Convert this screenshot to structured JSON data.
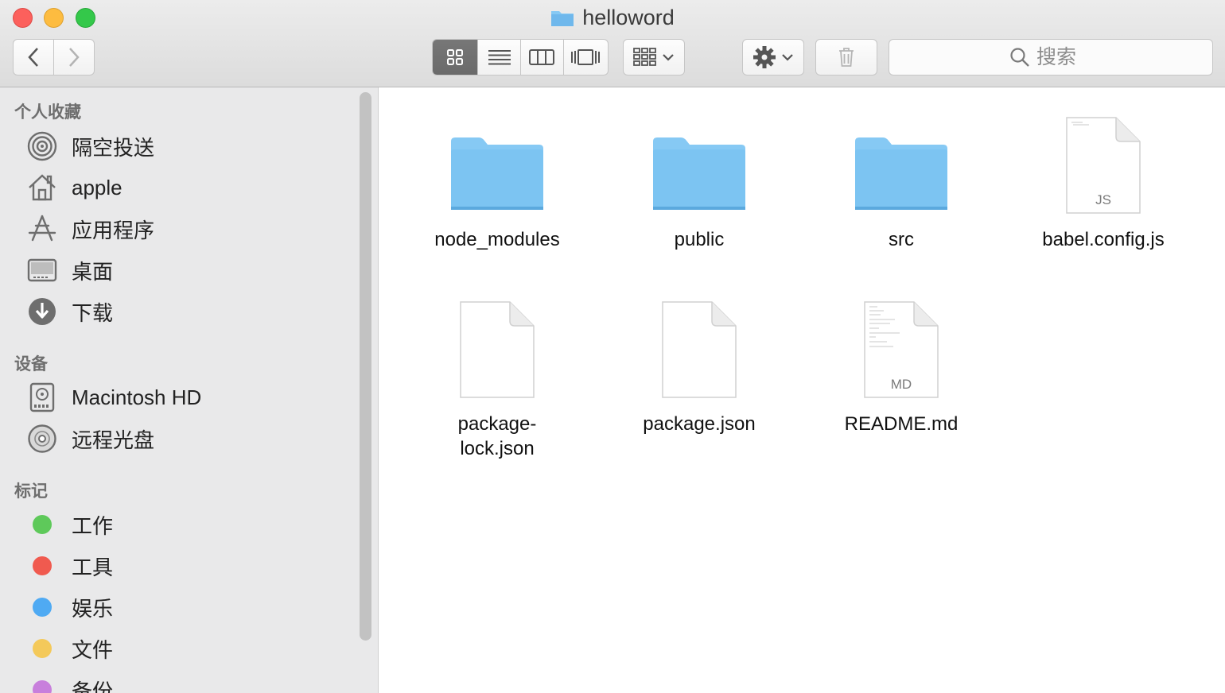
{
  "window": {
    "title": "helloword"
  },
  "toolbar": {
    "nav": {
      "back": "back-icon",
      "forward": "forward-icon"
    },
    "view_modes": [
      "icon-view-icon",
      "list-view-icon",
      "column-view-icon",
      "cover-flow-icon"
    ],
    "active_view": 0,
    "search": {
      "placeholder": "搜索"
    }
  },
  "sidebar": {
    "favorites": {
      "title": "个人收藏",
      "items": [
        {
          "label": "隔空投送",
          "icon": "airdrop-icon"
        },
        {
          "label": "apple",
          "icon": "home-icon"
        },
        {
          "label": "应用程序",
          "icon": "applications-icon"
        },
        {
          "label": "桌面",
          "icon": "desktop-icon"
        },
        {
          "label": "下载",
          "icon": "download-icon"
        }
      ]
    },
    "devices": {
      "title": "设备",
      "items": [
        {
          "label": "Macintosh HD",
          "icon": "hard-drive-icon"
        },
        {
          "label": "远程光盘",
          "icon": "disc-icon"
        }
      ]
    },
    "tags": {
      "title": "标记",
      "items": [
        {
          "label": "工作",
          "color": "#5ec95a"
        },
        {
          "label": "工具",
          "color": "#f05a4f"
        },
        {
          "label": "娱乐",
          "color": "#4faaf3"
        },
        {
          "label": "文件",
          "color": "#f4c95a"
        },
        {
          "label": "备份",
          "color": "#c87fdc"
        }
      ]
    }
  },
  "files": [
    {
      "name": "node_modules",
      "kind": "folder"
    },
    {
      "name": "public",
      "kind": "folder"
    },
    {
      "name": "src",
      "kind": "folder"
    },
    {
      "name": "babel.config.js",
      "kind": "document",
      "badge": "JS"
    },
    {
      "name": "package-lock.json",
      "kind": "document",
      "badge": ""
    },
    {
      "name": "package.json",
      "kind": "document",
      "badge": ""
    },
    {
      "name": "README.md",
      "kind": "document",
      "badge": "MD"
    }
  ],
  "colors": {
    "folder": "#7cc4f2",
    "folder_tab": "#8ccdf5",
    "accent_active": "#6d6d6d"
  }
}
